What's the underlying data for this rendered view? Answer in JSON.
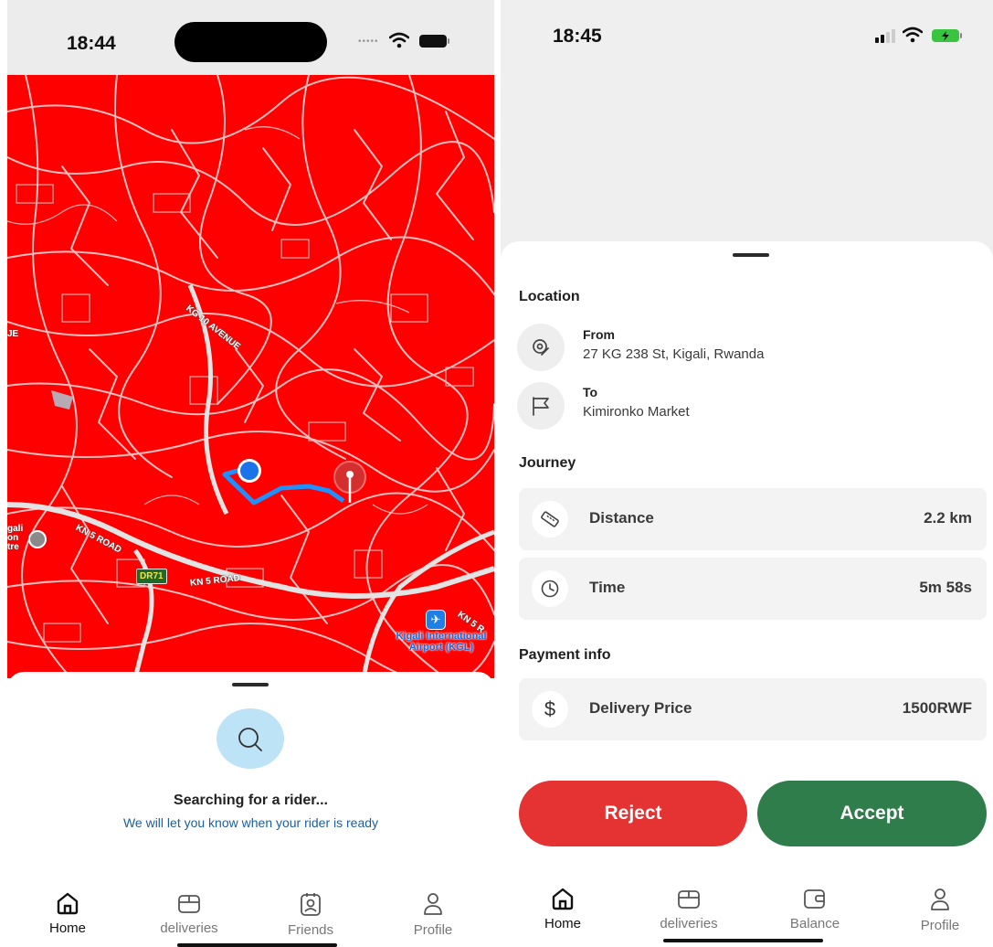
{
  "left_screen": {
    "status_time": "18:44",
    "map_labels": {
      "kg_avenue": "KG 10 AVENUE",
      "kn5_road_1": "KN 5 ROAD",
      "kn5_road_2": "KN 5 ROAD",
      "kn5_road_3": "KN 5 R",
      "dr71": "DR71",
      "airport": "Kigali International Airport (KGL)",
      "edge_top": "JE",
      "edge_bottom": "gali on tre"
    },
    "search": {
      "title": "Searching for a rider...",
      "subtitle": "We will let you know when your rider is ready"
    },
    "nav": [
      "Home",
      "deliveries",
      "Friends",
      "Profile"
    ]
  },
  "right_screen": {
    "status_time": "18:45",
    "location_title": "Location",
    "from_label": "From",
    "from_value": "27 KG 238 St, Kigali, Rwanda",
    "to_label": "To",
    "to_value": "Kimironko Market",
    "journey_title": "Journey",
    "distance_label": "Distance",
    "distance_value": "2.2 km",
    "time_label": "Time",
    "time_value": "5m 58s",
    "payment_title": "Payment info",
    "price_label": "Delivery Price",
    "price_value": "1500RWF",
    "reject_label": "Reject",
    "accept_label": "Accept",
    "nav": [
      "Home",
      "deliveries",
      "Balance",
      "Profile"
    ]
  },
  "colors": {
    "map_background": "#ff0000",
    "reject": "#e53232",
    "accept": "#2f7d4a",
    "search_circle": "#bde3f7",
    "subtitle_blue": "#1d5e9c"
  },
  "icons": [
    "search-icon",
    "location-pin-icon",
    "flag-icon",
    "ruler-icon",
    "clock-icon",
    "dollar-icon",
    "home-icon",
    "box-icon",
    "contact-badge-icon",
    "wallet-icon",
    "person-icon",
    "wifi-icon",
    "battery-icon",
    "signal-icon"
  ]
}
